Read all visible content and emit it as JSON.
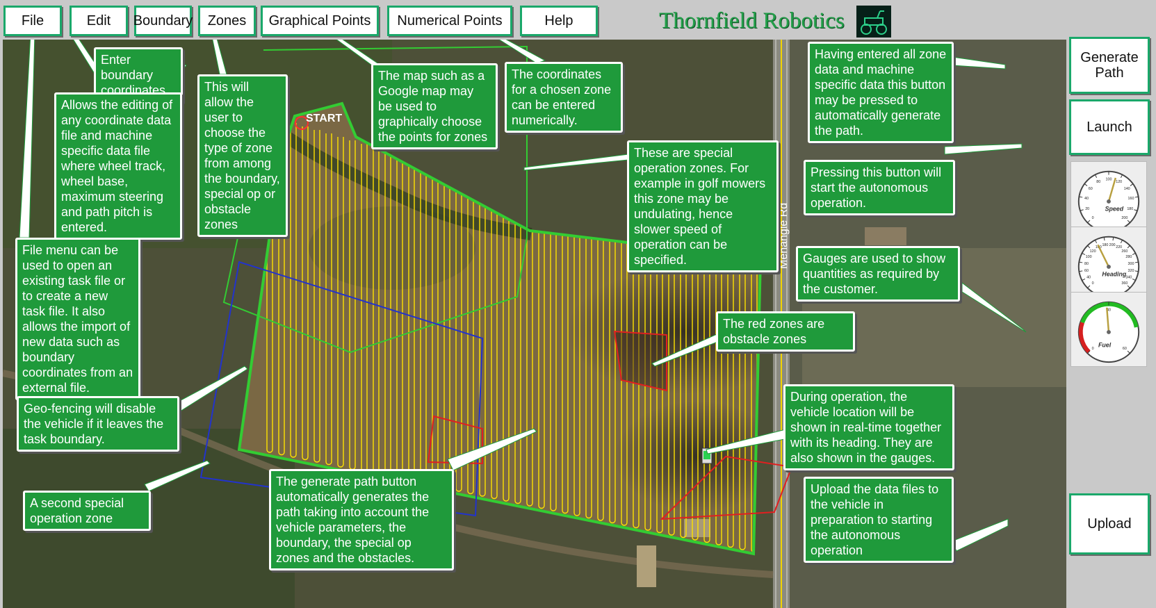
{
  "menu": {
    "file": "File",
    "edit": "Edit",
    "boundary": "Boundary",
    "zones": "Zones",
    "graphical_points": "Graphical Points",
    "numerical_points": "Numerical Points",
    "help": "Help"
  },
  "brand": "Thornfield Robotics",
  "side_buttons": {
    "generate_path": "Generate Path",
    "launch": "Launch",
    "upload": "Upload"
  },
  "map": {
    "start_label": "START",
    "road_label": "Menangle Rd"
  },
  "gauges": {
    "speed": {
      "label": "Speed",
      "ticks": [
        "0",
        "20",
        "40",
        "60",
        "80",
        "100",
        "120",
        "140",
        "160",
        "180",
        "200"
      ],
      "value": 112
    },
    "heading": {
      "label": "Heading",
      "ticks": [
        "0",
        "40",
        "60",
        "80",
        "100",
        "120",
        "160",
        "180",
        "200",
        "220",
        "260",
        "280",
        "300",
        "320",
        "340",
        "360"
      ],
      "value": 145
    },
    "fuel": {
      "label": "Fuel",
      "ticks": [
        "0",
        "40",
        "60"
      ],
      "value": 29
    }
  },
  "callouts": {
    "boundary": "Enter boundary coordinates",
    "edit": "Allows the editing of any coordinate data file and machine specific data file where wheel track, wheel base, maximum steering and path pitch is entered.",
    "zones": "This will allow the user to choose the type of zone from among the boundary, special op or obstacle zones",
    "graphical": "The map such as a Google map may be used to graphically choose the points for zones",
    "numerical": "The coordinates for a chosen zone can be entered numerically.",
    "generate_path": "Having entered all zone data and machine specific data this button may be pressed to automatically generate the path.",
    "special_zones": "These are special operation zones. For example in golf mowers this zone may be undulating, hence slower speed of operation can be specified.",
    "launch": "Pressing this button will start the autonomous operation.",
    "gauges": "Gauges are used to show quantities as required by the customer.",
    "file": "File menu can be used to open an existing task file or to create a new task file. It also allows the import of new data such as boundary coordinates from an external file.",
    "obstacle": "The red zones are obstacle zones",
    "geofence": "Geo-fencing will disable the vehicle if it leaves the task boundary.",
    "vehicle": "During operation, the vehicle location will be shown in real-time together with its heading. They are also shown in the gauges.",
    "second_zone": "A second special operation zone",
    "generate_explain": "The generate path button automatically generates the path taking into account the vehicle parameters, the boundary, the special op zones and the obstacles.",
    "upload": "Upload the data files to the vehicle in preparation to starting the autonomous operation"
  },
  "colors": {
    "menu_border": "#1aa86a",
    "callout_bg": "#1f9a3b",
    "boundary": "#33cc33",
    "path": "#ffe300",
    "obstacle": "#e02020",
    "special_zone_blue": "#2233cc",
    "brand": "#23a04a"
  }
}
